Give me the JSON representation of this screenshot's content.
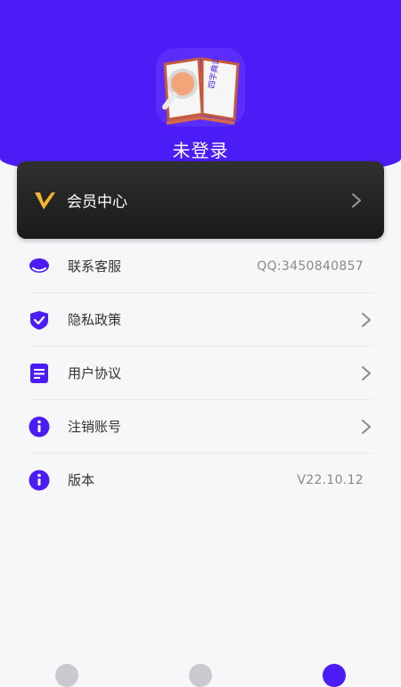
{
  "header": {
    "login_status": "未登录",
    "app_icon": "dictionary-book-icon",
    "app_icon_text": "四字典词",
    "bg_color": "#4b1cf5"
  },
  "vip": {
    "label": "会员中心",
    "logo_icon": "vip-v-icon"
  },
  "menu": {
    "items": [
      {
        "label": "联系客服",
        "value": "QQ:3450840857",
        "icon": "customer-service-icon"
      },
      {
        "label": "隐私政策",
        "icon": "shield-check-icon"
      },
      {
        "label": "用户协议",
        "icon": "document-icon"
      },
      {
        "label": "注销账号",
        "icon": "info-icon"
      },
      {
        "label": "版本",
        "value": "V22.10.12",
        "icon": "info-icon"
      }
    ]
  },
  "tabbar": {
    "tabs": [
      {
        "icon": "home-tab-icon",
        "active": false
      },
      {
        "icon": "explore-tab-icon",
        "active": false
      },
      {
        "icon": "profile-tab-icon",
        "active": true
      }
    ],
    "accent": "#4b1cf5"
  }
}
